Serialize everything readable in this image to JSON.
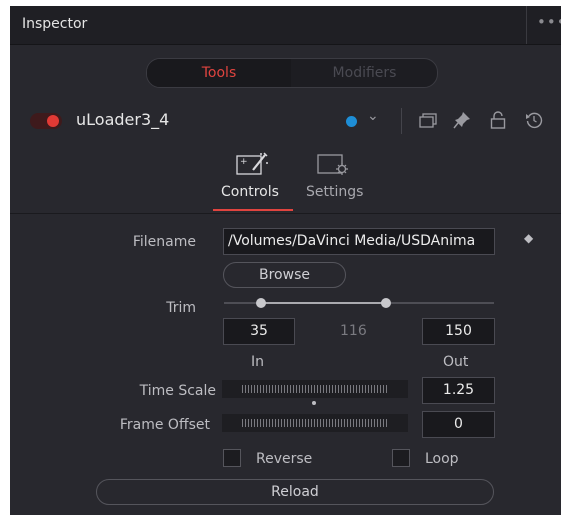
{
  "panel": {
    "title": "Inspector",
    "menu_label": "•••"
  },
  "mode_tabs": {
    "tools": "Tools",
    "modifiers": "Modifiers",
    "active": "Tools"
  },
  "node": {
    "name": "uLoader3_4",
    "enabled": true,
    "color": "#1e8ed6",
    "header_icons": [
      "chevron-down-icon",
      "copy-icon",
      "pin-icon",
      "lock-icon",
      "reset-icon"
    ]
  },
  "sub_tabs": {
    "controls": "Controls",
    "settings": "Settings",
    "active": "Controls"
  },
  "form": {
    "filename": {
      "label": "Filename",
      "value": "/Volumes/DaVinci Media/USDAnima"
    },
    "browse_label": "Browse",
    "trim": {
      "label": "Trim",
      "in_value": "35",
      "length": "116",
      "out_value": "150",
      "in_label": "In",
      "out_label": "Out"
    },
    "time_scale": {
      "label": "Time Scale",
      "value": "1.25"
    },
    "frame_offset": {
      "label": "Frame Offset",
      "value": "0"
    },
    "reverse": {
      "label": "Reverse",
      "checked": false
    },
    "loop": {
      "label": "Loop",
      "checked": false
    },
    "reload_label": "Reload"
  },
  "colors": {
    "accent_red": "#e0443f",
    "panel_bg": "#28282e"
  }
}
